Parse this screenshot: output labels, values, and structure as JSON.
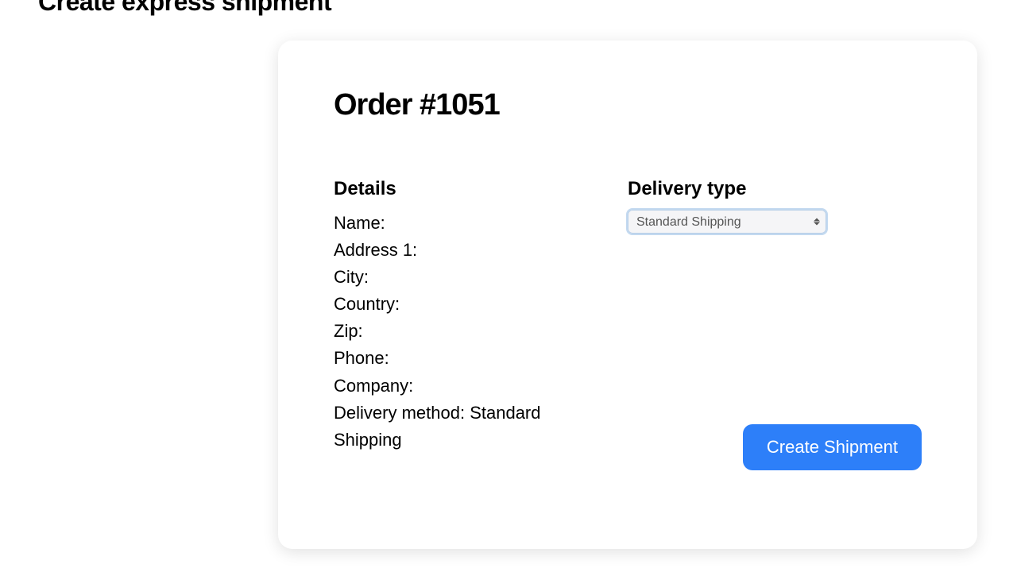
{
  "page": {
    "title": "Create express shipment"
  },
  "order": {
    "title": "Order #1051"
  },
  "details": {
    "heading": "Details",
    "name_label": "Name:",
    "address1_label": "Address 1:",
    "city_label": "City:",
    "country_label": "Country:",
    "zip_label": "Zip:",
    "phone_label": "Phone:",
    "company_label": "Company:",
    "delivery_method_label": "Delivery method:",
    "delivery_method_value": "Standard Shipping"
  },
  "delivery": {
    "heading": "Delivery type",
    "selected": "Standard Shipping"
  },
  "actions": {
    "create": "Create Shipment"
  }
}
